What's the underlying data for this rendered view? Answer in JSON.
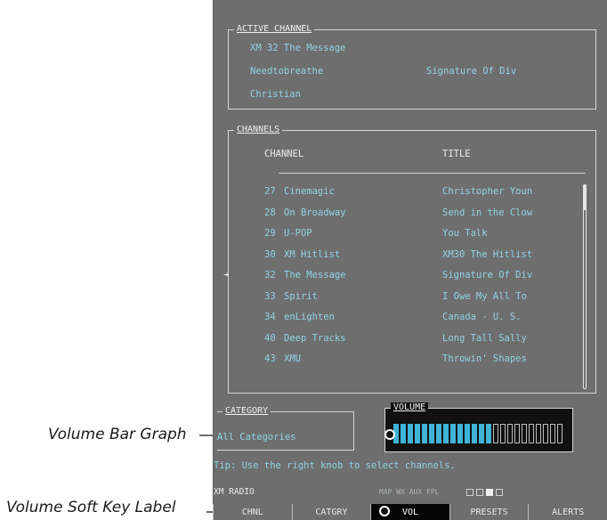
{
  "active_channel": {
    "title": "ACTIVE CHANNEL",
    "line1": "XM 32   The Message",
    "artist": "Needtobreathe",
    "song": "Signature Of Div",
    "category": "Christian"
  },
  "channels": {
    "title": "CHANNELS",
    "col_channel": "CHANNEL",
    "col_title": "TITLE",
    "rows": [
      {
        "num": "27",
        "name": "Cinemagic",
        "title": "Christopher Youn"
      },
      {
        "num": "28",
        "name": "On Broadway",
        "title": "Send in the Clow"
      },
      {
        "num": "29",
        "name": "U-POP",
        "title": "You Talk"
      },
      {
        "num": "30",
        "name": "XM Hitlist",
        "title": "XM30 The Hitlist"
      },
      {
        "num": "32",
        "name": "The Message",
        "title": "Signature Of Div"
      },
      {
        "num": "33",
        "name": "Spirit",
        "title": "I Owe My All To"
      },
      {
        "num": "34",
        "name": "enLighten",
        "title": "Canada - U. S."
      },
      {
        "num": "40",
        "name": "Deep Tracks",
        "title": "Long Tall Sally"
      },
      {
        "num": "43",
        "name": "XMU",
        "title": "Throwin' Shapes"
      }
    ],
    "selected_index": 4,
    "selector_glyph": "➜"
  },
  "category": {
    "title": "CATEGORY",
    "value": "All Categories"
  },
  "volume": {
    "title": "VOLUME",
    "level_fraction": 0.58,
    "segments_total": 24
  },
  "tip": "Tip: Use the right knob to select channels.",
  "status": {
    "left": "XM RADIO",
    "right": "MAP WX AUX FPL"
  },
  "softkeys": [
    {
      "label": "CHNL",
      "selected": false
    },
    {
      "label": "CATGRY",
      "selected": false
    },
    {
      "label": "VOL",
      "selected": true
    },
    {
      "label": "PRESETS",
      "selected": false
    },
    {
      "label": "ALERTS",
      "selected": false
    }
  ],
  "callouts": {
    "volume_bar": "Volume Bar Graph",
    "volume_softkey": "Volume Soft Key Label"
  },
  "colors": {
    "accent": "#3fb4d6",
    "text_cyan": "#8fd3e6",
    "bezel": "#6e6e6e"
  }
}
